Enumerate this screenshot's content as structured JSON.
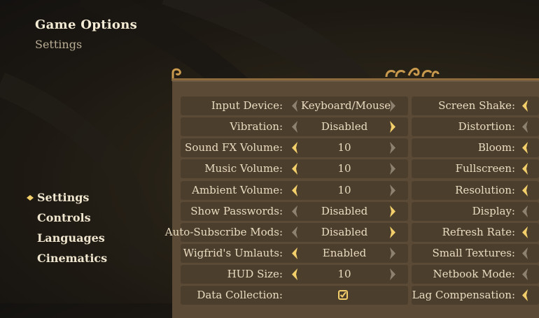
{
  "header": {
    "title": "Game Options",
    "subtitle": "Settings"
  },
  "nav": {
    "items": [
      {
        "label": "Settings",
        "active": true
      },
      {
        "label": "Controls",
        "active": false
      },
      {
        "label": "Languages",
        "active": false
      },
      {
        "label": "Cinematics",
        "active": false
      }
    ]
  },
  "left_options": [
    {
      "label": "Input Device:",
      "value": "Keyboard/Mouse",
      "left_active": false,
      "right_active": false
    },
    {
      "label": "Vibration:",
      "value": "Disabled",
      "left_active": false,
      "right_active": true
    },
    {
      "label": "Sound FX Volume:",
      "value": "10",
      "left_active": true,
      "right_active": false
    },
    {
      "label": "Music Volume:",
      "value": "10",
      "left_active": true,
      "right_active": false
    },
    {
      "label": "Ambient Volume:",
      "value": "10",
      "left_active": true,
      "right_active": false
    },
    {
      "label": "Show Passwords:",
      "value": "Disabled",
      "left_active": false,
      "right_active": true
    },
    {
      "label": "Auto-Subscribe Mods:",
      "value": "Disabled",
      "left_active": false,
      "right_active": true
    },
    {
      "label": "Wigfrid's Umlauts:",
      "value": "Enabled",
      "left_active": true,
      "right_active": false
    },
    {
      "label": "HUD Size:",
      "value": "10",
      "left_active": true,
      "right_active": false
    },
    {
      "label": "Data Collection:",
      "value": "",
      "checked": true
    }
  ],
  "right_options": [
    {
      "label": "Screen Shake:",
      "left_active": true
    },
    {
      "label": "Distortion:",
      "left_active": false
    },
    {
      "label": "Bloom:",
      "left_active": true
    },
    {
      "label": "Fullscreen:",
      "left_active": true
    },
    {
      "label": "Resolution:",
      "left_active": true
    },
    {
      "label": "Display:",
      "left_active": false
    },
    {
      "label": "Refresh Rate:",
      "left_active": true
    },
    {
      "label": "Small Textures:",
      "left_active": false
    },
    {
      "label": "Netbook Mode:",
      "left_active": false
    },
    {
      "label": "Lag Compensation:",
      "left_active": true
    }
  ],
  "colors": {
    "arrow_active": "#f2cf6a",
    "arrow_inactive": "#8d8170",
    "panel": "#5a4a36",
    "row": "#4c3e2d",
    "text": "#e9dcc0"
  },
  "icons": {
    "nav_marker": "diamond-arrow-icon",
    "left_arrow": "chevron-left-icon",
    "right_arrow": "chevron-right-icon",
    "checkbox": "checkbox-checked-icon"
  }
}
